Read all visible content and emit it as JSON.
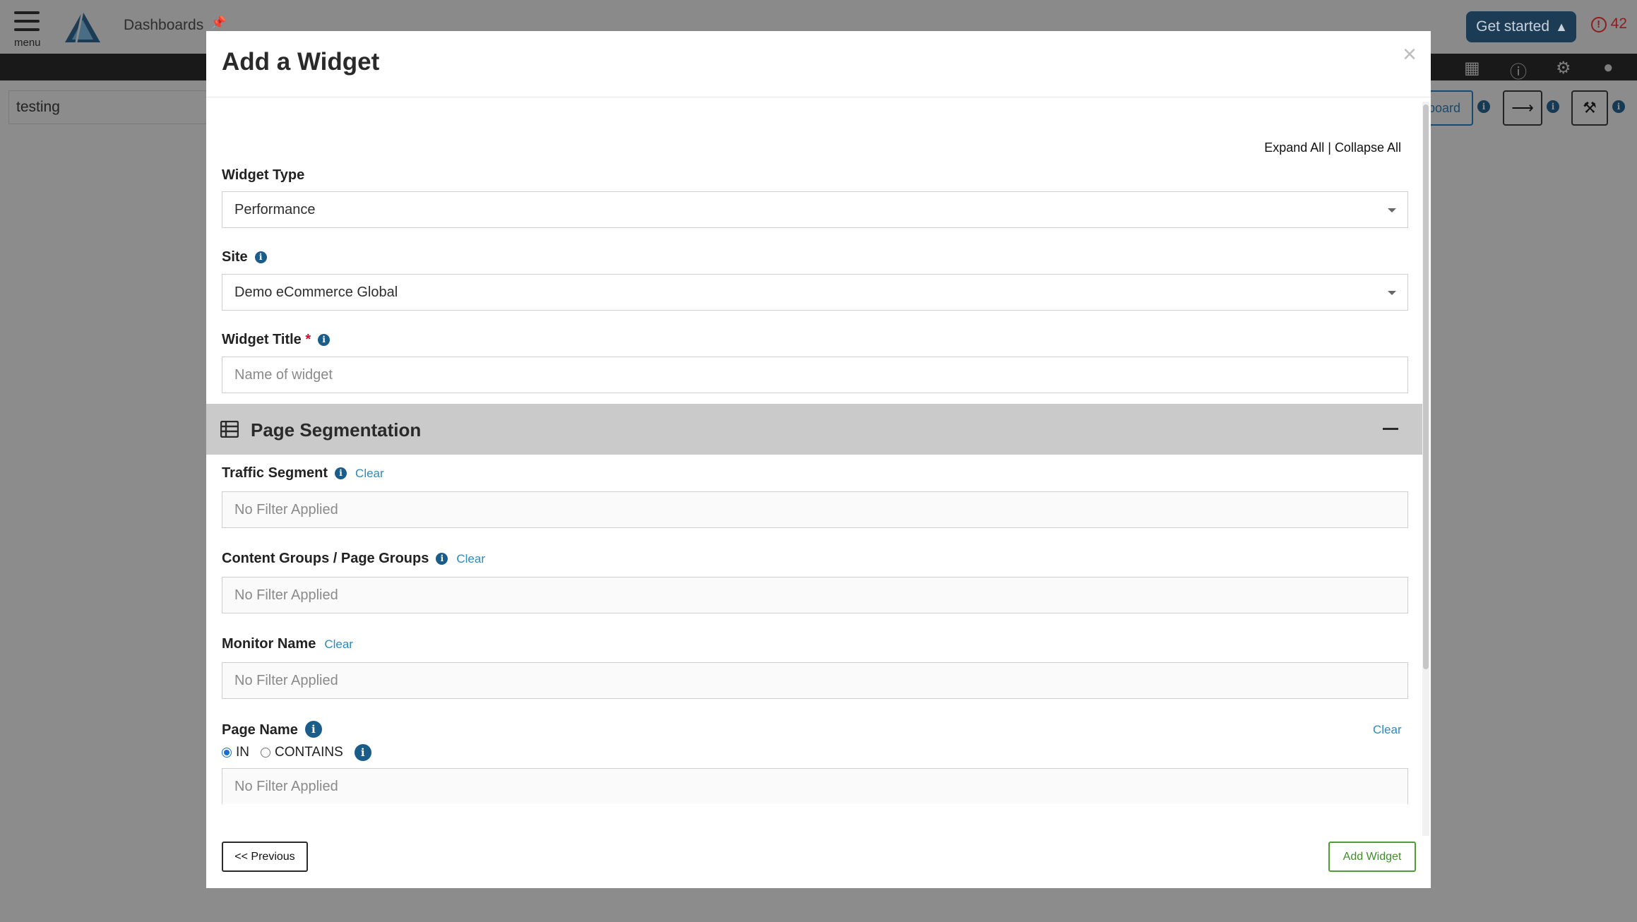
{
  "app": {
    "menu_label": "menu",
    "breadcrumb": "Dashboards",
    "get_started": "Get started",
    "alert_count": "42",
    "alert_symbol": "!",
    "dashboard_name": "testing",
    "dashboard_button_partial": "board",
    "icons": [
      "hamburger-icon",
      "pin-icon",
      "rocket-icon",
      "alert-icon",
      "report-icon",
      "help-icon",
      "gear-icon",
      "user-icon",
      "share-icon",
      "wrench-icon",
      "info-icon"
    ]
  },
  "modal": {
    "title": "Add a Widget",
    "close_symbol": "×",
    "expand_all": "Expand All",
    "separator": " | ",
    "collapse_all": "Collapse All",
    "info_symbol": "i",
    "widget_type": {
      "label": "Widget Type",
      "value": "Performance"
    },
    "site": {
      "label": "Site",
      "value": "Demo eCommerce Global"
    },
    "widget_title": {
      "label": "Widget Title",
      "required": "*",
      "placeholder": "Name of widget"
    },
    "section": {
      "title": "Page Segmentation",
      "collapse_icon": "minus-icon"
    },
    "clear_label": "Clear",
    "traffic_segment": {
      "label": "Traffic Segment",
      "value": "No Filter Applied"
    },
    "content_groups": {
      "label": "Content Groups / Page Groups",
      "value": "No Filter Applied"
    },
    "monitor_name": {
      "label": "Monitor Name",
      "value": "No Filter Applied"
    },
    "page_name": {
      "label": "Page Name",
      "options": [
        "IN",
        "CONTAINS"
      ],
      "selected": "IN",
      "value": "No Filter Applied"
    },
    "previous_button": "<< Previous",
    "add_button": "Add Widget"
  },
  "colors": {
    "accent_blue": "#1a5c8a",
    "link_blue": "#2a8bbf",
    "add_green": "#3f8f28",
    "required_red": "#c8102e",
    "section_gray": "#cacaca"
  }
}
